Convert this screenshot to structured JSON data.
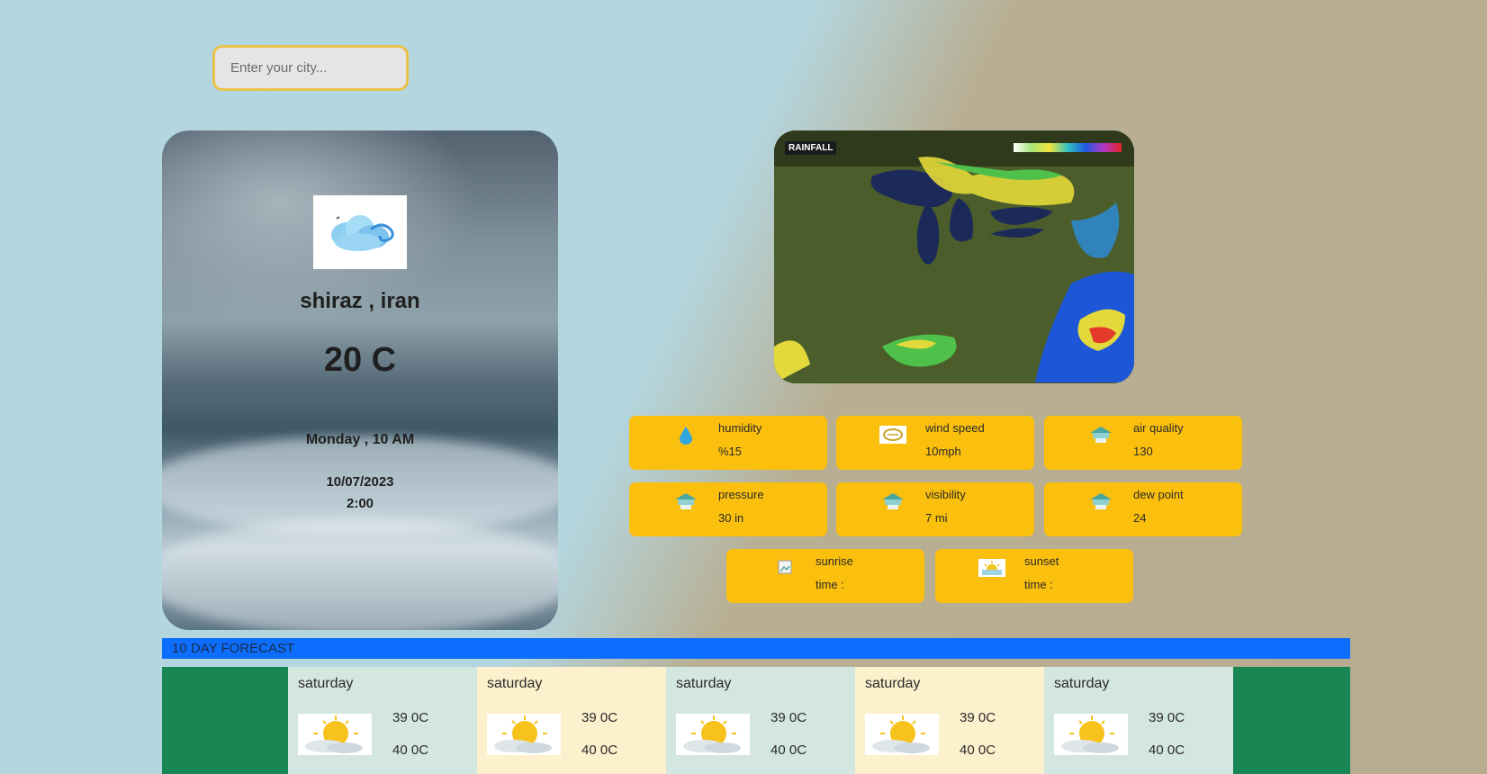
{
  "search": {
    "placeholder": "Enter your city..."
  },
  "current": {
    "city": "shiraz , iran",
    "temperature": "20 C",
    "day_time": "Monday , 10 AM",
    "date": "10/07/2023",
    "time": "2:00"
  },
  "map": {
    "title": "RAINFALL"
  },
  "stats": [
    {
      "label": "humidity",
      "value": "%15",
      "icon": "water-drop-icon"
    },
    {
      "label": "wind speed",
      "value": "10mph",
      "icon": "wind-icon"
    },
    {
      "label": "air quality",
      "value": "130",
      "icon": "weather-station-icon"
    },
    {
      "label": "pressure",
      "value": "30 in",
      "icon": "weather-station-icon"
    },
    {
      "label": "visibility",
      "value": "7 mi",
      "icon": "weather-station-icon"
    },
    {
      "label": "dew point",
      "value": "24",
      "icon": "weather-station-icon"
    },
    {
      "label": "sunrise",
      "value": "time :",
      "icon": "broken-image-icon"
    },
    {
      "label": "sunset",
      "value": "time :",
      "icon": "sunset-icon"
    }
  ],
  "forecast": {
    "title": "10 DAY FORECAST",
    "days": [
      {
        "day": "saturday",
        "high": "39 0C",
        "low": "40 0C",
        "bg": "#d3e6df"
      },
      {
        "day": "saturday",
        "high": "39 0C",
        "low": "40 0C",
        "bg": "#fdf0cd"
      },
      {
        "day": "saturday",
        "high": "39 0C",
        "low": "40 0C",
        "bg": "#d3e6df"
      },
      {
        "day": "saturday",
        "high": "39 0C",
        "low": "40 0C",
        "bg": "#fdf0cd"
      },
      {
        "day": "saturday",
        "high": "39 0C",
        "low": "40 0C",
        "bg": "#d3e6df"
      }
    ]
  },
  "colors": {
    "stat_bg": "#fbc00e",
    "forecast_bar": "#0d6efd",
    "forecast_bg": "#198754"
  }
}
